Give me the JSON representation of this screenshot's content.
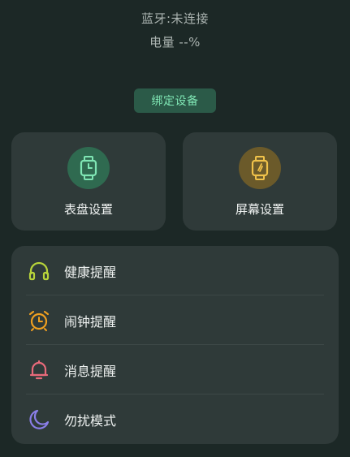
{
  "status": {
    "bluetooth": "蓝牙:未连接",
    "battery": "电量 --%"
  },
  "bind_button": "绑定设备",
  "cards": [
    {
      "label": "表盘设置",
      "icon": "watch-face-icon",
      "color": "#7fe6b4"
    },
    {
      "label": "屏幕设置",
      "icon": "watch-screen-icon",
      "color": "#f0c24a"
    }
  ],
  "menu": [
    {
      "label": "健康提醒",
      "icon": "headset-icon",
      "color": "#b7d33a"
    },
    {
      "label": "闹钟提醒",
      "icon": "alarm-clock-icon",
      "color": "#f0a020"
    },
    {
      "label": "消息提醒",
      "icon": "bell-icon",
      "color": "#e86a7a"
    },
    {
      "label": "勿扰模式",
      "icon": "moon-icon",
      "color": "#8a7ee8"
    }
  ]
}
